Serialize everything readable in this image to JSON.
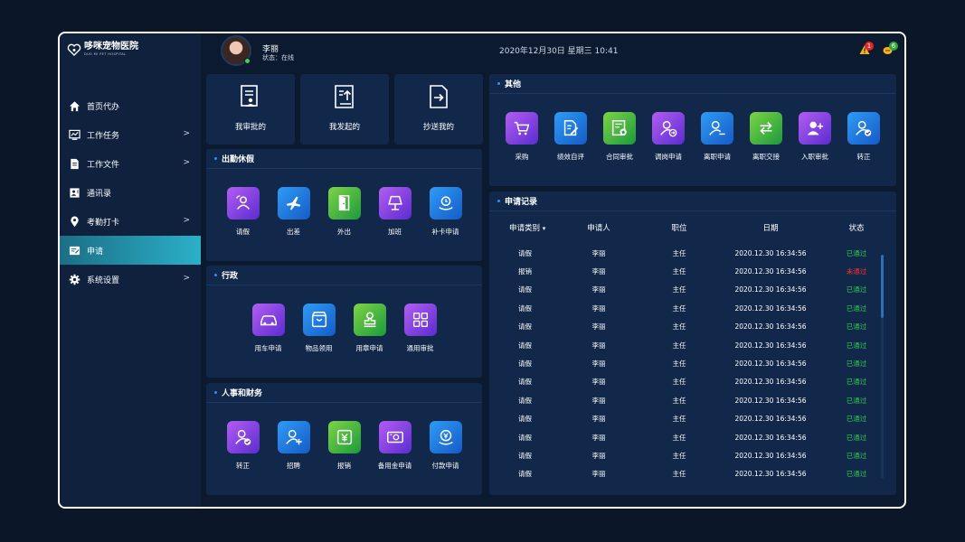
{
  "app": {
    "name": "哆咪宠物医院",
    "subtitle": "DUO MI PET HOSPITAL"
  },
  "sidebar": {
    "items": [
      {
        "label": "首页代办",
        "icon": "home-icon",
        "chevron": false
      },
      {
        "label": "工作任务",
        "icon": "chart-icon",
        "chevron": true
      },
      {
        "label": "工作文件",
        "icon": "document-icon",
        "chevron": true
      },
      {
        "label": "通讯录",
        "icon": "contacts-icon",
        "chevron": false
      },
      {
        "label": "考勤打卡",
        "icon": "location-icon",
        "chevron": true
      },
      {
        "label": "申请",
        "icon": "apply-icon",
        "chevron": false,
        "active": true
      },
      {
        "label": "系统设置",
        "icon": "gear-icon",
        "chevron": true
      }
    ],
    "chevron_glyph": ">"
  },
  "header": {
    "user_name": "李丽",
    "user_status": "状态：在线",
    "datetime": "2020年12月30日  星期三  10:41",
    "alert_count": "1",
    "coin_count": "6"
  },
  "quick_actions": [
    {
      "label": "我审批的",
      "icon": "approve-doc-icon"
    },
    {
      "label": "我发起的",
      "icon": "upload-doc-icon"
    },
    {
      "label": "抄送我的",
      "icon": "forward-doc-icon"
    }
  ],
  "sections": {
    "attendance": {
      "title": "出勤休假",
      "items": [
        {
          "label": "请假",
          "icon": "leave-icon",
          "color": "purple"
        },
        {
          "label": "出差",
          "icon": "plane-icon",
          "color": "blue"
        },
        {
          "label": "外出",
          "icon": "door-icon",
          "color": "green"
        },
        {
          "label": "加班",
          "icon": "lamp-icon",
          "color": "purple"
        },
        {
          "label": "补卡申请",
          "icon": "clock-card-icon",
          "color": "blue"
        }
      ]
    },
    "admin": {
      "title": "行政",
      "items": [
        {
          "label": "用车申请",
          "icon": "car-icon",
          "color": "purple"
        },
        {
          "label": "物品领用",
          "icon": "bag-icon",
          "color": "blue"
        },
        {
          "label": "用章申请",
          "icon": "stamp-icon",
          "color": "green"
        },
        {
          "label": "通用审批",
          "icon": "grid-icon",
          "color": "purple"
        }
      ]
    },
    "hr_finance": {
      "title": "人事和财务",
      "items": [
        {
          "label": "转正",
          "icon": "user-check-icon",
          "color": "purple"
        },
        {
          "label": "招聘",
          "icon": "user-plus-icon",
          "color": "blue"
        },
        {
          "label": "报销",
          "icon": "yen-icon",
          "color": "green"
        },
        {
          "label": "备用金申请",
          "icon": "cash-icon",
          "color": "purple"
        },
        {
          "label": "付款申请",
          "icon": "payment-icon",
          "color": "blue"
        }
      ]
    },
    "other": {
      "title": "其他",
      "items": [
        {
          "label": "采购",
          "icon": "cart-icon",
          "color": "purple"
        },
        {
          "label": "绩效自评",
          "icon": "edit-doc-icon",
          "color": "blue"
        },
        {
          "label": "合同审批",
          "icon": "contract-icon",
          "color": "green"
        },
        {
          "label": "调岗申请",
          "icon": "transfer-user-icon",
          "color": "purple"
        },
        {
          "label": "离职申请",
          "icon": "user-minus-icon",
          "color": "blue"
        },
        {
          "label": "离职交接",
          "icon": "exchange-icon",
          "color": "green"
        },
        {
          "label": "入职审批",
          "icon": "user-add-icon",
          "color": "purple"
        },
        {
          "label": "转正",
          "icon": "user-check-icon",
          "color": "blue"
        }
      ]
    }
  },
  "records": {
    "title": "申请记录",
    "columns": [
      "申请类别",
      "申请人",
      "职位",
      "日期",
      "状态"
    ],
    "sort_indicator": "▾",
    "rows": [
      {
        "type": "请假",
        "applicant": "李丽",
        "position": "主任",
        "date": "2020.12.30  16:34:56",
        "status": "已通过",
        "ok": true
      },
      {
        "type": "报销",
        "applicant": "李丽",
        "position": "主任",
        "date": "2020.12.30  16:34:56",
        "status": "未通过",
        "ok": false
      },
      {
        "type": "请假",
        "applicant": "李丽",
        "position": "主任",
        "date": "2020.12.30  16:34:56",
        "status": "已通过",
        "ok": true
      },
      {
        "type": "请假",
        "applicant": "李丽",
        "position": "主任",
        "date": "2020.12.30  16:34:56",
        "status": "已通过",
        "ok": true
      },
      {
        "type": "请假",
        "applicant": "李丽",
        "position": "主任",
        "date": "2020.12.30  16:34:56",
        "status": "已通过",
        "ok": true
      },
      {
        "type": "请假",
        "applicant": "李丽",
        "position": "主任",
        "date": "2020.12.30  16:34:56",
        "status": "已通过",
        "ok": true
      },
      {
        "type": "请假",
        "applicant": "李丽",
        "position": "主任",
        "date": "2020.12.30  16:34:56",
        "status": "已通过",
        "ok": true
      },
      {
        "type": "请假",
        "applicant": "李丽",
        "position": "主任",
        "date": "2020.12.30  16:34:56",
        "status": "已通过",
        "ok": true
      },
      {
        "type": "请假",
        "applicant": "李丽",
        "position": "主任",
        "date": "2020.12.30  16:34:56",
        "status": "已通过",
        "ok": true
      },
      {
        "type": "请假",
        "applicant": "李丽",
        "position": "主任",
        "date": "2020.12.30  16:34:56",
        "status": "已通过",
        "ok": true
      },
      {
        "type": "请假",
        "applicant": "李丽",
        "position": "主任",
        "date": "2020.12.30  16:34:56",
        "status": "已通过",
        "ok": true
      },
      {
        "type": "请假",
        "applicant": "李丽",
        "position": "主任",
        "date": "2020.12.30  16:34:56",
        "status": "已通过",
        "ok": true
      },
      {
        "type": "请假",
        "applicant": "李丽",
        "position": "主任",
        "date": "2020.12.30  16:34:56",
        "status": "已通过",
        "ok": true
      }
    ]
  },
  "colors": {
    "accent": "#2bb0c8",
    "bg": "#0c1a30",
    "panel": "#12284a",
    "ok": "#2ecc4a",
    "error": "#ff3030"
  }
}
